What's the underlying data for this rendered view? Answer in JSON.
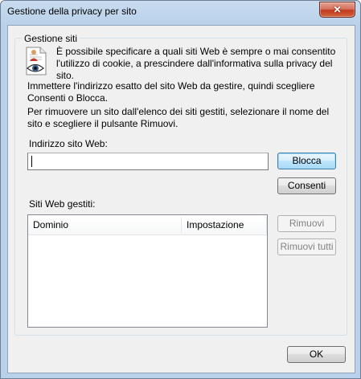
{
  "window": {
    "title": "Gestione della privacy per sito",
    "close_glyph": "✕"
  },
  "group": {
    "label": "Gestione siti",
    "icon": "privacy-report-icon",
    "description": "È possibile specificare a quali siti Web è sempre o mai consentito l'utilizzo di cookie, a prescindere dall'informativa sulla privacy del sito.",
    "instruction_1": "Immettere l'indirizzo esatto del sito Web da gestire, quindi scegliere Consenti o Blocca.",
    "instruction_2": "Per rimuovere un sito dall'elenco dei siti gestiti, selezionare il nome del sito e scegliere il pulsante Rimuovi."
  },
  "address": {
    "label": "Indirizzo sito Web:",
    "value": ""
  },
  "buttons": {
    "block": "Blocca",
    "allow": "Consenti",
    "remove": "Rimuovi",
    "remove_all": "Rimuovi tutti",
    "ok": "OK"
  },
  "managed_sites": {
    "label": "Siti Web gestiti:",
    "columns": [
      "Dominio",
      "Impostazione"
    ],
    "rows": []
  }
}
